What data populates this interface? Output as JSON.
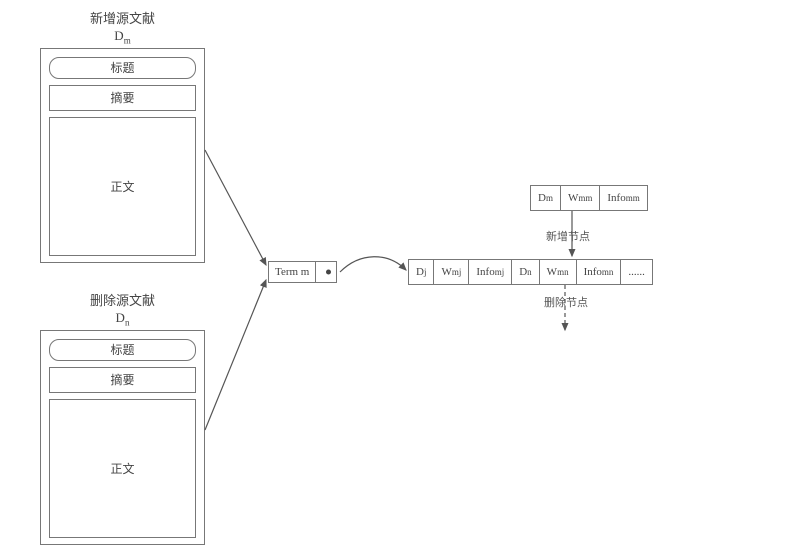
{
  "docs": {
    "new": {
      "title": "新增源文献",
      "sub_html": "D<sub class=\"sub\">m</sub>",
      "pill": "标题",
      "abstract": "摘要",
      "body": "正文"
    },
    "del": {
      "title": "删除源文献",
      "sub_html": "D<sub class=\"sub\">n</sub>",
      "pill": "标题",
      "abstract": "摘要",
      "body": "正文"
    }
  },
  "term": {
    "label": "Term m"
  },
  "labels": {
    "add_node": "新增节点",
    "delete_node": "删除节点"
  },
  "new_node": {
    "d_html": "D<sub class=\"sub\">m</sub>",
    "w_html": "W<sub class=\"sub\">mm</sub>",
    "info_html": "Info<sub class=\"sub\">mm</sub>"
  },
  "row": {
    "c1_html": "D<sub class=\"sub\">j</sub>",
    "c2_html": "W<sub class=\"sub\">mj</sub>",
    "c3_html": "Info<sub class=\"sub\">mj</sub>",
    "c4_html": "D<sub class=\"sub\">n</sub>",
    "c5_html": "W<sub class=\"sub\">mn</sub>",
    "c6_html": "Info<sub class=\"sub\">mn</sub>",
    "c7": "......"
  }
}
